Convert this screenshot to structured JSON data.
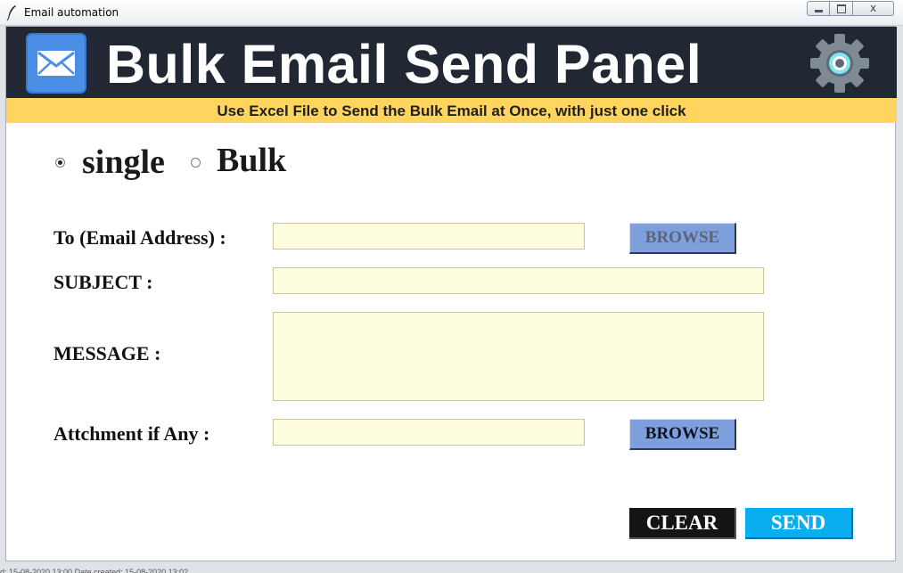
{
  "window": {
    "title": "Email automation",
    "close_glyph": "x"
  },
  "header": {
    "title": "Bulk Email Send Panel",
    "subtitle": "Use Excel File to Send the Bulk Email at Once, with just one click",
    "logo_icon": "mail-envelope-icon",
    "settings_icon": "gear-icon",
    "colors": {
      "bar": "#222833",
      "subbar": "#ffd45f",
      "logo": "#4a8ee6",
      "gear_inner": "#7ee8ee"
    }
  },
  "mode": {
    "options": [
      {
        "label": "single",
        "selected": true
      },
      {
        "label": "Bulk",
        "selected": false
      }
    ]
  },
  "form": {
    "to_label": "To (Email Address)  :",
    "to_value": "",
    "subject_label": "SUBJECT  :",
    "subject_value": "",
    "message_label": "MESSAGE  :",
    "message_value": "",
    "attachment_label": "Attchment if Any  :",
    "attachment_value": "",
    "browse_to_label": "BROWSE",
    "browse_attachment_label": "BROWSE"
  },
  "actions": {
    "clear_label": "CLEAR",
    "send_label": "SEND",
    "colors": {
      "clear": "#141414",
      "send": "#0aaeef"
    }
  },
  "statusbar": {
    "text": "d: 15-08-2020 13:00          Date created: 15-08-2020 13:02"
  }
}
